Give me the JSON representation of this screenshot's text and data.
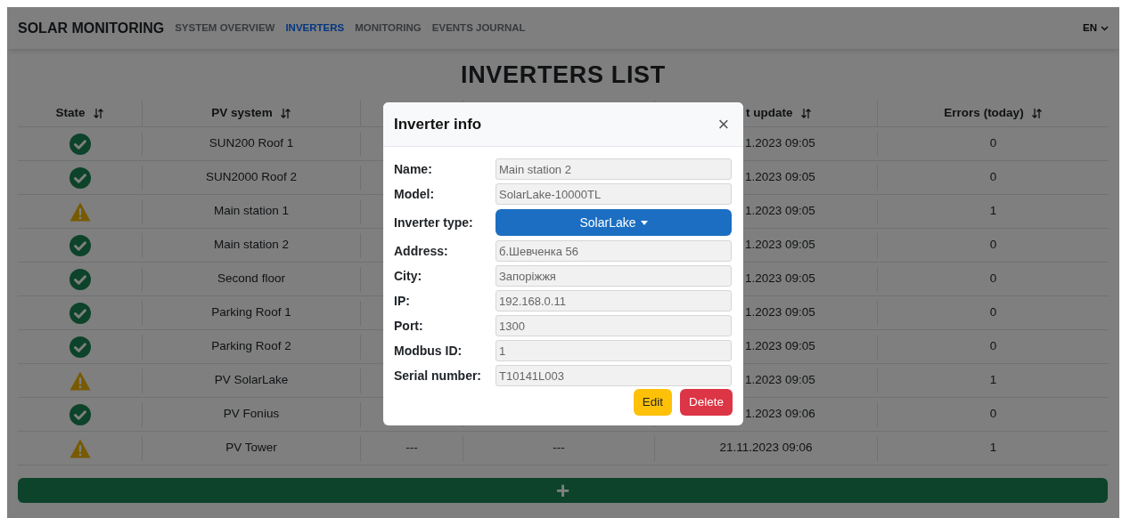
{
  "navbar": {
    "brand": "SOLAR MONITORING",
    "links": [
      {
        "label": "SYSTEM OVERVIEW",
        "selected": false
      },
      {
        "label": "INVERTERS",
        "selected": true
      },
      {
        "label": "MONITORING",
        "selected": false
      },
      {
        "label": "EVENTS JOURNAL",
        "selected": false
      }
    ],
    "language": "EN"
  },
  "page_title": "INVERTERS LIST",
  "table": {
    "columns": {
      "state": "State",
      "pv_system": "PV system",
      "last_update": "t update",
      "errors": "Errors (today)"
    },
    "rows": [
      {
        "kind": "ok",
        "pv_system": "SUN200 Roof 1",
        "last_update": "1.2023 09:05",
        "errors": "0"
      },
      {
        "kind": "ok",
        "pv_system": "SUN2000 Roof 2",
        "last_update": "1.2023 09:05",
        "errors": "0"
      },
      {
        "kind": "warning",
        "pv_system": "Main station 1",
        "last_update": "1.2023 09:05",
        "errors": "1"
      },
      {
        "kind": "ok",
        "pv_system": "Main station 2",
        "last_update": "1.2023 09:05",
        "errors": "0"
      },
      {
        "kind": "ok",
        "pv_system": "Second floor",
        "last_update": "1.2023 09:05",
        "errors": "0"
      },
      {
        "kind": "ok",
        "pv_system": "Parking Roof 1",
        "last_update": "1.2023 09:05",
        "errors": "0"
      },
      {
        "kind": "ok",
        "pv_system": "Parking Roof 2",
        "last_update": "1.2023 09:05",
        "errors": "0"
      },
      {
        "kind": "warning",
        "pv_system": "PV SolarLake",
        "last_update": "1.2023 09:05",
        "errors": "1"
      },
      {
        "kind": "ok",
        "pv_system": "PV Fonius",
        "last_update": "1.2023 09:06",
        "errors": "0"
      },
      {
        "kind": "warning",
        "pv_system": "PV Tower",
        "column_3": "---",
        "column_4": "---",
        "last_update": "21.11.2023 09:06",
        "errors": "1"
      }
    ]
  },
  "add_button": {
    "label": "+"
  },
  "modal": {
    "title": "Inverter info",
    "close": "×",
    "fields": [
      {
        "kind": "text",
        "label": "Name:",
        "value": "Main station 2"
      },
      {
        "kind": "text",
        "label": "Model:",
        "value": "SolarLake-10000TL"
      },
      {
        "kind": "dropdown",
        "label": "Inverter type:",
        "value": "SolarLake"
      },
      {
        "kind": "text",
        "label": "Address:",
        "value": "б.Шевченка 56"
      },
      {
        "kind": "text",
        "label": "City:",
        "value": "Запоріжжя"
      },
      {
        "kind": "text",
        "label": "IP:",
        "value": "192.168.0.11"
      },
      {
        "kind": "text",
        "label": "Port:",
        "value": "1300"
      },
      {
        "kind": "text",
        "label": "Modbus ID:",
        "value": "1"
      },
      {
        "kind": "text",
        "label": "Serial number:",
        "value": "T10141L003"
      }
    ],
    "buttons": [
      {
        "kind": "edit",
        "label": "Edit"
      },
      {
        "kind": "delete",
        "label": "Delete"
      }
    ]
  }
}
